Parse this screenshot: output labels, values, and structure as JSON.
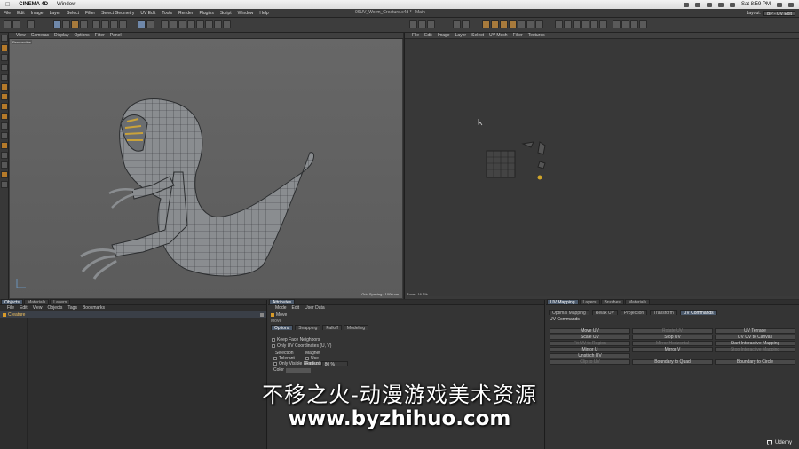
{
  "mac_menubar": {
    "app": "CINEMA 4D",
    "menu": "Window",
    "clock": "Sat 8:59 PM"
  },
  "c4d_menubar": {
    "items": [
      "File",
      "Edit",
      "Image",
      "Layer",
      "Select",
      "Filter",
      "Select Geometry",
      "UV Edit",
      "Tools",
      "Render",
      "Plugins",
      "Script",
      "Window",
      "Help"
    ],
    "title": "06UV_Worm_Creature.c4d * - Main",
    "layout_label": "Layout:",
    "layout_value": "BP - UV Edit"
  },
  "viewport": {
    "menu": [
      "View",
      "Cameras",
      "Display",
      "Options",
      "Filter",
      "Panel"
    ],
    "label": "Perspective",
    "grid_spacing": "Grid Spacing : 1000 cm"
  },
  "uv_view": {
    "menu": [
      "File",
      "Edit",
      "Image",
      "Layer",
      "Select",
      "UV Mesh",
      "Filter",
      "Textures"
    ],
    "zoom": "Zoom: 16.7%"
  },
  "object_manager": {
    "tabs": [
      "Objects",
      "Materials",
      "Layers"
    ],
    "menu": [
      "File",
      "Edit",
      "View",
      "Objects",
      "Tags",
      "Bookmarks"
    ],
    "object": "Creature"
  },
  "attributes": {
    "tab": "Attributes",
    "menu": [
      "Mode",
      "Edit",
      "User Data"
    ],
    "title": "Move",
    "subtitle": "Move",
    "tabs": [
      "Options",
      "Snapping",
      "Falloff",
      "Modeling"
    ],
    "options": [
      "Keep Face Neighbors",
      "Only UV Coordinates (U, V)"
    ],
    "selection_label": "Selection",
    "magnet_label": "Magnet",
    "tolerant": "Tolerant",
    "only_visible": "Only Visible Elements",
    "use_label": "Use",
    "radius_label": "Radius",
    "radius_value": "80 %",
    "color_label": "Color"
  },
  "uv_manager": {
    "tabs": [
      "UV Mapping",
      "Layers",
      "Brushes",
      "Materials"
    ],
    "subtabs": [
      "Optimal Mapping",
      "Relax UV",
      "Projection",
      "Transform",
      "UV Commands"
    ],
    "section": "UV Commands",
    "buttons": [
      [
        "Move UV",
        "Rotate UV",
        "UV Terrace"
      ],
      [
        "Scale UV",
        "Stop UV",
        "UV UV to Canvas"
      ],
      [
        "Fit UV to Region",
        "Mirror Horizontal",
        "Start Interactive Mapping"
      ],
      [
        "Mirror U",
        "Mirror V",
        "Stop Interactive Mapping"
      ],
      [
        "Unstitch UV",
        "Boundary to Quad",
        "Boundary to Circle"
      ],
      [
        "Clip to UV",
        "",
        ""
      ]
    ],
    "dim": [
      "Fit UV to Region",
      "Mirror Horizontal",
      "Stop Interactive Mapping",
      "Clip to UV",
      "Rotate UV"
    ]
  },
  "watermark": {
    "line1": "不移之火-动漫游戏美术资源",
    "line2": "www.byzhihuo.com"
  },
  "udemy": "Udemy"
}
